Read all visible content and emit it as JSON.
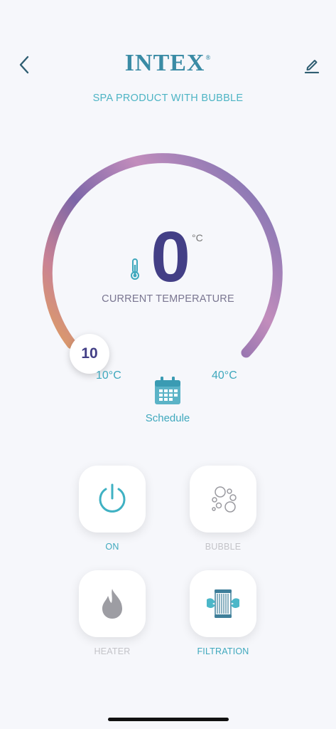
{
  "header": {
    "brand": "INTEX",
    "brand_mark": "®",
    "subtitle": "SPA PRODUCT WITH BUBBLE",
    "back_icon": "chevron-left-icon",
    "edit_icon": "pencil-icon"
  },
  "dial": {
    "current_temperature": "0",
    "unit": "°C",
    "current_label": "CURRENT TEMPERATURE",
    "setpoint": "10",
    "min_label": "10°C",
    "max_label": "40°C",
    "min_value": 10,
    "max_value": 40,
    "setpoint_value": 10
  },
  "schedule": {
    "label": "Schedule",
    "icon": "calendar-icon"
  },
  "controls": [
    {
      "label": "ON",
      "icon": "power-icon",
      "active": true
    },
    {
      "label": "BUBBLE",
      "icon": "bubbles-icon",
      "active": false
    },
    {
      "label": "HEATER",
      "icon": "flame-icon",
      "active": false
    },
    {
      "label": "FILTRATION",
      "icon": "filter-cartridge-icon",
      "active": true
    }
  ],
  "colors": {
    "accent": "#3fa8bd",
    "brand": "#3a8ba5",
    "temp_text": "#433f86",
    "inactive": "#c3c3c8",
    "arc_start": "#e2a35a",
    "arc_mid": "#7c66a8",
    "arc_end": "#8a78b4"
  }
}
